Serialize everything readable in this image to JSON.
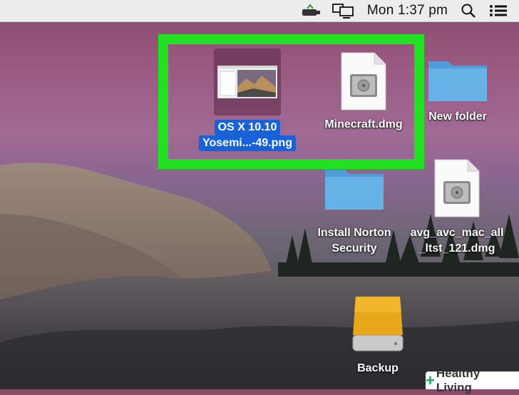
{
  "menubar": {
    "clock": "Mon 1:37 pm",
    "icons": [
      "usb-drive-icon",
      "display-mirroring-icon",
      "spotlight-search-icon",
      "notification-center-icon"
    ]
  },
  "desktop": {
    "items": [
      {
        "line1": "OS X 10.10",
        "line2": "Yosemi...-49.png",
        "selected": true,
        "type": "image-file"
      },
      {
        "line1": "Minecraft.dmg",
        "line2": "",
        "selected": false,
        "type": "disk-image"
      },
      {
        "line1": "New folder",
        "line2": "",
        "selected": false,
        "type": "folder"
      },
      {
        "line1": "Install Norton",
        "line2": "Security",
        "selected": false,
        "type": "folder"
      },
      {
        "line1": "avg_avc_mac_all",
        "line2": "_ltst_121.dmg",
        "selected": false,
        "type": "disk-image"
      },
      {
        "line1": "Backup",
        "line2": "",
        "selected": false,
        "type": "external-drive"
      }
    ]
  },
  "colors": {
    "highlight": "#22e022",
    "selection": "#1862d8",
    "folder": "#5aa7dc",
    "drive": "#e8a71a"
  },
  "watermark": {
    "text": "Healthy Living"
  }
}
